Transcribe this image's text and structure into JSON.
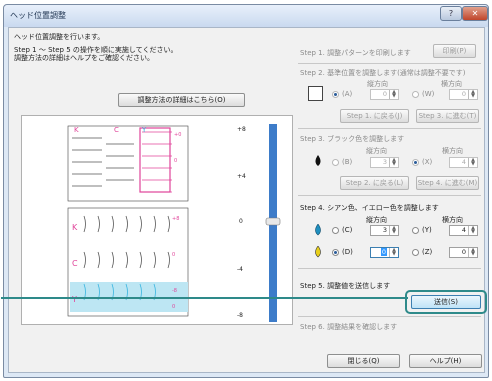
{
  "window": {
    "title": "ヘッド位置調整",
    "help_glyph": "?",
    "close_glyph": "✕"
  },
  "left": {
    "intro_line1": "ヘッド位置調整を行います。",
    "intro_line2": "Step 1 ～ Step 5 の操作を順に実施してください。",
    "intro_line3": "調整方法の詳細はヘルプをご確認ください。",
    "method_link": "調整方法の詳細はこちら(O)"
  },
  "preview": {
    "col_labels": [
      "K",
      "C",
      "Y"
    ],
    "row_labels": [
      "K",
      "C",
      "Y"
    ],
    "scale_labels": [
      "+8",
      "+4",
      "0",
      "-4",
      "-8"
    ],
    "pattern_marks": [
      "+0",
      "0",
      "+8",
      "0",
      "-8",
      "0"
    ]
  },
  "step1": {
    "label": "Step 1. 調整パターンを印刷します",
    "print_button": "印刷(P)"
  },
  "step2": {
    "label": "Step 2. 基準位置を調整します(通常は調整不要です)",
    "col_v": "縦方向",
    "col_h": "横方向",
    "radio_a": "(A)",
    "radio_w": "(W)",
    "val_a": "0",
    "val_w": "0",
    "back": "Step 1. に戻る(J)",
    "next": "Step 3. に進む(T)"
  },
  "step3": {
    "label": "Step 3. ブラック色を調整します",
    "col_v": "縦方向",
    "col_h": "横方向",
    "radio_b": "(B)",
    "radio_x": "(X)",
    "val_b": "3",
    "val_x": "4",
    "back": "Step 2. に戻る(L)",
    "next": "Step 4. に進む(M)"
  },
  "step4": {
    "label": "Step 4. シアン色、イエロー色を調整します",
    "col_v": "縦方向",
    "col_h": "横方向",
    "radio_c": "(C)",
    "radio_y": "(Y)",
    "radio_d": "(D)",
    "radio_z": "(Z)",
    "val_c": "3",
    "val_y": "4",
    "val_d": "0",
    "val_z": "0"
  },
  "step5": {
    "label": "Step 5. 調整値を送信します",
    "send_button": "送信(S)"
  },
  "step6": {
    "label": "Step 6. 調整結果を確認します"
  },
  "footer": {
    "close_button": "閉じる(Q)",
    "help_button": "ヘルプ(H)"
  },
  "colors": {
    "accent": "#2e8a8a",
    "cyan": "#39b5e0",
    "magenta": "#e0449a",
    "slider": "#3d7cc9"
  }
}
